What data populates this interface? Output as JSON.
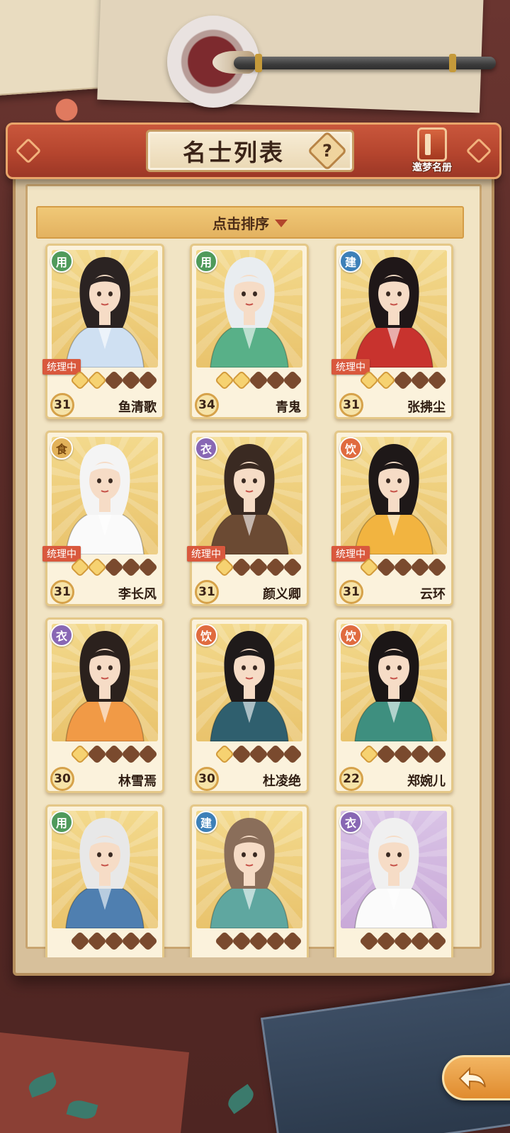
{
  "header": {
    "title": "名士列表",
    "help_label": "?",
    "dream_list_label": "邀梦名册"
  },
  "sort": {
    "label": "点击排序"
  },
  "cards": [
    {
      "name": "鱼清歌",
      "level": "31",
      "type": "用",
      "type_kind": "use",
      "managing": "统理中",
      "stars_on": 2,
      "stars_total": 5,
      "hair": "#2b2322",
      "robe": "#cfe0f2"
    },
    {
      "name": "青鬼",
      "level": "34",
      "type": "用",
      "type_kind": "use",
      "managing": "",
      "stars_on": 2,
      "stars_total": 5,
      "hair": "#e9edf0",
      "robe": "#58b088"
    },
    {
      "name": "张拂尘",
      "level": "31",
      "type": "建",
      "type_kind": "build",
      "managing": "统理中",
      "stars_on": 2,
      "stars_total": 5,
      "hair": "#1f1718",
      "robe": "#c8332e"
    },
    {
      "name": "李长风",
      "level": "31",
      "type": "食",
      "type_kind": "food",
      "managing": "统理中",
      "stars_on": 2,
      "stars_total": 5,
      "hair": "#f4f4f4",
      "robe": "#fafafa"
    },
    {
      "name": "颜义卿",
      "level": "31",
      "type": "衣",
      "type_kind": "cloth",
      "managing": "统理中",
      "stars_on": 1,
      "stars_total": 5,
      "hair": "#3a2a22",
      "robe": "#6b4a33"
    },
    {
      "name": "云环",
      "level": "31",
      "type": "饮",
      "type_kind": "drink",
      "managing": "统理中",
      "stars_on": 1,
      "stars_total": 5,
      "hair": "#1e1818",
      "robe": "#f2b440"
    },
    {
      "name": "林雪焉",
      "level": "30",
      "type": "衣",
      "type_kind": "cloth",
      "managing": "",
      "stars_on": 1,
      "stars_total": 5,
      "hair": "#2b211d",
      "robe": "#f19a46"
    },
    {
      "name": "杜凌绝",
      "level": "30",
      "type": "饮",
      "type_kind": "drink",
      "managing": "",
      "stars_on": 1,
      "stars_total": 5,
      "hair": "#1f1a1a",
      "robe": "#2f5f6e"
    },
    {
      "name": "郑婉儿",
      "level": "22",
      "type": "饮",
      "type_kind": "drink",
      "managing": "",
      "stars_on": 1,
      "stars_total": 5,
      "hair": "#1b1616",
      "robe": "#3e8f7f"
    },
    {
      "name": "",
      "level": "",
      "type": "用",
      "type_kind": "use",
      "managing": "",
      "stars_on": 0,
      "stars_total": 5,
      "hair": "#e8e8e8",
      "robe": "#4f7fb0"
    },
    {
      "name": "",
      "level": "",
      "type": "建",
      "type_kind": "build",
      "managing": "",
      "stars_on": 0,
      "stars_total": 5,
      "hair": "#8a6e5a",
      "robe": "#5fa7a0"
    },
    {
      "name": "",
      "level": "",
      "type": "衣",
      "type_kind": "cloth",
      "managing": "",
      "stars_on": 0,
      "stars_total": 5,
      "hair": "#f0f0f0",
      "robe": "#fbfbfb",
      "rare": true
    }
  ]
}
